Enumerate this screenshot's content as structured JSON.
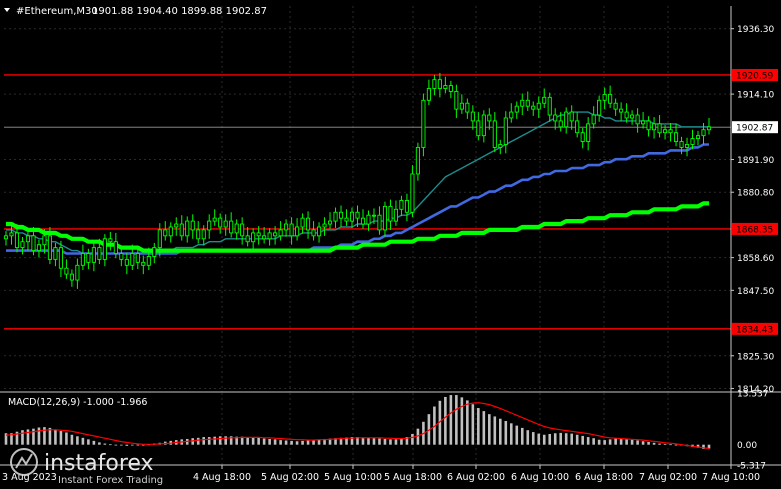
{
  "header": {
    "symbol": "#Ethereum,M30",
    "quote": "1901.88 1904.40 1899.88 1902.87"
  },
  "macd_header": {
    "label": "MACD(12,26,9) -1.000 -1.966"
  },
  "watermark": {
    "brand": "instaforex",
    "tagline": "Instant Forex Trading"
  },
  "colors": {
    "background": "#000000",
    "candle": "#00ff00",
    "level_line": "#ff0000",
    "ma_short": "#1e8c8c",
    "ma_mid": "#4169e1",
    "ma_long": "#00ff00",
    "current_price": "#ffffff",
    "macd_hist": "#c0c0c0",
    "macd_signal": "#ff0000"
  },
  "chart_data": [
    {
      "type": "candlestick",
      "panel": "price",
      "ylim": [
        1813,
        1944
      ],
      "y_ticks": [
        "1936.30",
        "1914.10",
        "1891.90",
        "1880.80",
        "1858.60",
        "1847.50",
        "1825.30",
        "1814.20"
      ],
      "x_ticks": [
        "4 Aug 18:00",
        "5 Aug 02:00",
        "5 Aug 10:00",
        "5 Aug 18:00",
        "6 Aug 02:00",
        "6 Aug 10:00",
        "6 Aug 18:00",
        "7 Aug 02:00",
        "7 Aug 10:00"
      ],
      "x_range_label": "3 Aug 2023",
      "current_price": "1902.87",
      "levels": [
        {
          "label": "1920.59",
          "value": 1920.59
        },
        {
          "label": "1868.35",
          "value": 1868.35
        },
        {
          "label": "1834.43",
          "value": 1834.43
        }
      ],
      "closes": [
        1866,
        1867,
        1862,
        1864,
        1866,
        1861,
        1863,
        1866,
        1858,
        1862,
        1855,
        1853,
        1851,
        1856,
        1860,
        1857,
        1862,
        1858,
        1865,
        1864,
        1860,
        1858,
        1856,
        1860,
        1857,
        1856,
        1859,
        1862,
        1868,
        1866,
        1869,
        1870,
        1866,
        1871,
        1868,
        1865,
        1868,
        1871,
        1872,
        1869,
        1871,
        1867,
        1870,
        1866,
        1864,
        1867,
        1866,
        1865,
        1867,
        1866,
        1868,
        1870,
        1866,
        1869,
        1872,
        1868,
        1866,
        1869,
        1870,
        1871,
        1874,
        1872,
        1871,
        1874,
        1872,
        1870,
        1873,
        1873,
        1868,
        1876,
        1871,
        1875,
        1878,
        1874,
        1887,
        1896,
        1912,
        1916,
        1919,
        1916,
        1917,
        1915,
        1909,
        1911,
        1908,
        1905,
        1900,
        1907,
        1905,
        1896,
        1897,
        1906,
        1908,
        1910,
        1912,
        1910,
        1909,
        1911,
        1913,
        1907,
        1905,
        1903,
        1908,
        1905,
        1901,
        1898,
        1904,
        1907,
        1912,
        1914,
        1911,
        1909,
        1908,
        1906,
        1907,
        1904,
        1905,
        1902,
        1904,
        1901,
        1902,
        1901,
        1898,
        1896,
        1897,
        1899,
        1900,
        1902,
        1903
      ],
      "series": [
        {
          "name": "",
          "values": [
            1868,
            1868,
            1867,
            1867,
            1866,
            1866,
            1865,
            1865,
            1864,
            1864,
            1863,
            1862,
            1861,
            1861,
            1860,
            1860,
            1860,
            1860,
            1860,
            1860,
            1860,
            1860,
            1860,
            1860,
            1860,
            1860,
            1860,
            1860,
            1861,
            1861,
            1861,
            1862,
            1862,
            1862,
            1862,
            1863,
            1863,
            1864,
            1864,
            1864,
            1865,
            1865,
            1865,
            1865,
            1865,
            1865,
            1865,
            1865,
            1865,
            1865,
            1866,
            1866,
            1866,
            1866,
            1867,
            1867,
            1867,
            1867,
            1868,
            1868,
            1868,
            1869,
            1869,
            1869,
            1870,
            1870,
            1870,
            1871,
            1871,
            1871,
            1872,
            1872,
            1873,
            1873,
            1874,
            1876,
            1878,
            1880,
            1882,
            1884,
            1886,
            1887,
            1888,
            1889,
            1890,
            1891,
            1892,
            1893,
            1894,
            1895,
            1896,
            1897,
            1898,
            1899,
            1900,
            1901,
            1902,
            1903,
            1904,
            1905,
            1906,
            1907,
            1907,
            1908,
            1908,
            1908,
            1908,
            1907,
            1907,
            1906,
            1906,
            1905,
            1905,
            1905,
            1905,
            1905,
            1905,
            1905,
            1904,
            1904,
            1904,
            1904,
            1904,
            1903,
            1903,
            1903,
            1903,
            1903,
            1903
          ]
        },
        {
          "name": "",
          "values": [
            1861,
            1861,
            1861,
            1861,
            1861,
            1861,
            1861,
            1861,
            1861,
            1861,
            1861,
            1860,
            1860,
            1860,
            1860,
            1860,
            1860,
            1860,
            1860,
            1860,
            1860,
            1860,
            1860,
            1860,
            1860,
            1860,
            1860,
            1860,
            1860,
            1860,
            1860,
            1860,
            1861,
            1861,
            1861,
            1861,
            1861,
            1861,
            1861,
            1861,
            1861,
            1861,
            1861,
            1861,
            1861,
            1861,
            1861,
            1861,
            1861,
            1861,
            1861,
            1861,
            1861,
            1861,
            1861,
            1861,
            1862,
            1862,
            1862,
            1862,
            1862,
            1863,
            1863,
            1863,
            1864,
            1864,
            1864,
            1865,
            1865,
            1866,
            1866,
            1867,
            1867,
            1868,
            1869,
            1870,
            1871,
            1872,
            1873,
            1874,
            1875,
            1876,
            1876,
            1877,
            1878,
            1879,
            1879,
            1880,
            1881,
            1881,
            1882,
            1883,
            1883,
            1884,
            1885,
            1885,
            1886,
            1886,
            1887,
            1887,
            1888,
            1888,
            1888,
            1889,
            1889,
            1889,
            1890,
            1890,
            1890,
            1891,
            1891,
            1892,
            1892,
            1892,
            1893,
            1893,
            1893,
            1894,
            1894,
            1894,
            1894,
            1895,
            1895,
            1895,
            1895,
            1896,
            1896,
            1897,
            1897
          ]
        },
        {
          "name": "",
          "values": [
            1870,
            1870,
            1869,
            1869,
            1868,
            1868,
            1868,
            1867,
            1867,
            1867,
            1866,
            1866,
            1865,
            1865,
            1865,
            1864,
            1864,
            1864,
            1863,
            1863,
            1863,
            1862,
            1862,
            1862,
            1862,
            1861,
            1861,
            1861,
            1861,
            1861,
            1861,
            1861,
            1861,
            1861,
            1861,
            1861,
            1861,
            1861,
            1861,
            1861,
            1861,
            1861,
            1861,
            1861,
            1861,
            1861,
            1861,
            1861,
            1861,
            1861,
            1861,
            1861,
            1861,
            1861,
            1861,
            1861,
            1861,
            1861,
            1861,
            1861,
            1862,
            1862,
            1862,
            1862,
            1862,
            1863,
            1863,
            1863,
            1863,
            1863,
            1864,
            1864,
            1864,
            1864,
            1864,
            1865,
            1865,
            1865,
            1865,
            1866,
            1866,
            1866,
            1866,
            1867,
            1867,
            1867,
            1867,
            1867,
            1868,
            1868,
            1868,
            1868,
            1868,
            1868,
            1869,
            1869,
            1869,
            1869,
            1870,
            1870,
            1870,
            1870,
            1871,
            1871,
            1871,
            1871,
            1872,
            1872,
            1872,
            1872,
            1873,
            1873,
            1873,
            1873,
            1874,
            1874,
            1874,
            1874,
            1875,
            1875,
            1875,
            1875,
            1875,
            1876,
            1876,
            1876,
            1876,
            1877,
            1877
          ]
        }
      ]
    },
    {
      "type": "bar",
      "panel": "MACD(12,26,9)",
      "ylim": [
        -5.317,
        13.537
      ],
      "y_ticks": [
        "13.537",
        "0.00",
        "-5.317"
      ],
      "histogram": [
        3,
        3,
        3.4,
        3.8,
        4,
        4.2,
        4.5,
        4.6,
        4.4,
        4,
        3.6,
        3.2,
        2.6,
        2.2,
        1.8,
        1.4,
        1,
        0.6,
        0.3,
        0.1,
        -0.1,
        -0.2,
        -0.3,
        -0.2,
        -0.1,
        0,
        0.1,
        0.3,
        0.5,
        0.8,
        1,
        1.2,
        1.4,
        1.5,
        1.7,
        1.8,
        2,
        2,
        2.1,
        2.2,
        2.2,
        2.2,
        2.1,
        2.1,
        2,
        1.9,
        1.8,
        1.6,
        1.5,
        1.4,
        1.2,
        1.1,
        1,
        0.9,
        1,
        1.1,
        1.2,
        1.3,
        1.5,
        1.6,
        1.7,
        1.8,
        1.9,
        2,
        2,
        1.9,
        1.8,
        1.7,
        1.6,
        1.5,
        1.4,
        1.4,
        1.6,
        2,
        2.8,
        4.2,
        6,
        8,
        10,
        11.5,
        12.5,
        13,
        13,
        12.4,
        11.6,
        10.6,
        9.6,
        8.8,
        8,
        7.4,
        6.8,
        6.2,
        5.6,
        5,
        4.4,
        3.8,
        3.3,
        2.9,
        2.6,
        2.8,
        3,
        3.1,
        3,
        2.9,
        2.6,
        2.3,
        2,
        1.7,
        1.3,
        1.2,
        1.4,
        1.6,
        1.6,
        1.5,
        1.3,
        1.1,
        0.9,
        0.7,
        0.5,
        0.3,
        0.2,
        0.1,
        0,
        -0.2,
        -0.4,
        -0.6,
        -0.8,
        -1.1,
        -1
      ],
      "signal": [
        2.5,
        2.6,
        2.8,
        3,
        3.2,
        3.4,
        3.6,
        3.8,
        3.9,
        3.9,
        3.8,
        3.7,
        3.5,
        3.2,
        2.9,
        2.6,
        2.3,
        2,
        1.7,
        1.4,
        1.1,
        0.8,
        0.6,
        0.4,
        0.2,
        0.1,
        0.1,
        0.1,
        0.2,
        0.3,
        0.4,
        0.6,
        0.7,
        0.9,
        1,
        1.2,
        1.3,
        1.4,
        1.5,
        1.6,
        1.7,
        1.8,
        1.8,
        1.9,
        1.9,
        1.9,
        1.9,
        1.8,
        1.8,
        1.7,
        1.6,
        1.5,
        1.4,
        1.3,
        1.3,
        1.2,
        1.2,
        1.3,
        1.3,
        1.4,
        1.5,
        1.6,
        1.7,
        1.7,
        1.8,
        1.8,
        1.8,
        1.8,
        1.8,
        1.7,
        1.7,
        1.6,
        1.6,
        1.7,
        1.9,
        2.3,
        2.9,
        3.8,
        4.8,
        6,
        7.2,
        8.3,
        9.3,
        10,
        10.6,
        10.9,
        11,
        10.8,
        10.5,
        10,
        9.5,
        8.9,
        8.3,
        7.7,
        7.1,
        6.5,
        5.9,
        5.3,
        4.8,
        4.4,
        4.1,
        3.9,
        3.7,
        3.5,
        3.3,
        3.1,
        2.9,
        2.6,
        2.3,
        2,
        1.8,
        1.7,
        1.6,
        1.5,
        1.4,
        1.3,
        1.2,
        1,
        0.9,
        0.7,
        0.5,
        0.4,
        0.2,
        0,
        -0.2,
        -0.4,
        -0.6,
        -0.8,
        -1
      ]
    }
  ]
}
